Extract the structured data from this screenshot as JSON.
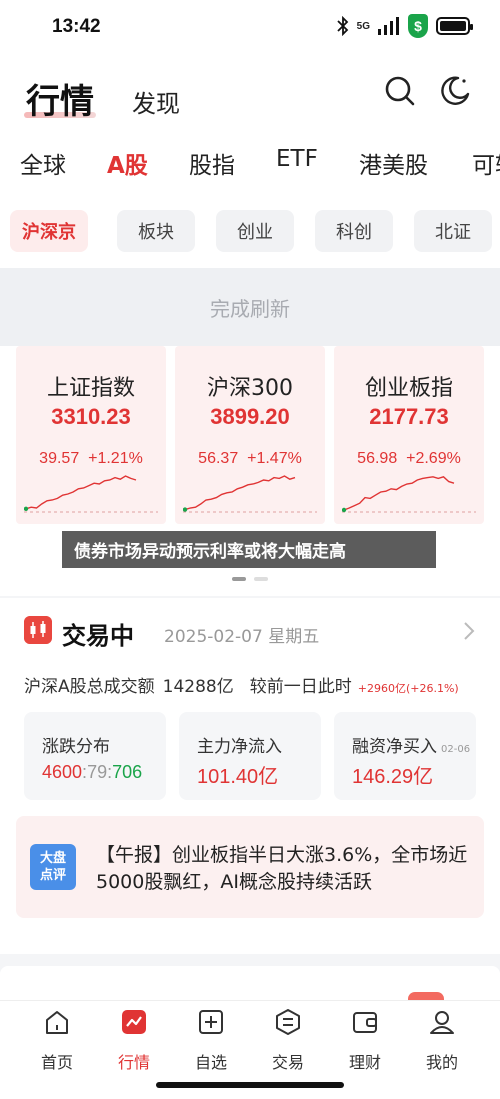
{
  "status": {
    "time": "13:42",
    "network": "5G",
    "shield_symbol": "$"
  },
  "header": {
    "title": "行情",
    "subtitle": "发现",
    "search_icon": "search-icon",
    "theme_icon": "moon-icon"
  },
  "tabs": [
    "全球",
    "A股",
    "股指",
    "ETF",
    "港美股",
    "可转"
  ],
  "active_tab": "A股",
  "chips": [
    "沪深京",
    "板块",
    "创业",
    "科创",
    "北证"
  ],
  "active_chip": "沪深京",
  "refresh_text": "完成刷新",
  "indices": [
    {
      "name": "上证指数",
      "value": "3310.23",
      "change": "39.57",
      "pct": "+1.21%",
      "spark": [
        0.08,
        0.12,
        0.1,
        0.2,
        0.28,
        0.3,
        0.34,
        0.42,
        0.45,
        0.5,
        0.58,
        0.6,
        0.66,
        0.72,
        0.7,
        0.78,
        0.8,
        0.86,
        0.82,
        0.9,
        0.84,
        0.8
      ]
    },
    {
      "name": "沪深300",
      "value": "3899.20",
      "change": "56.37",
      "pct": "+1.47%",
      "spark": [
        0.06,
        0.1,
        0.12,
        0.2,
        0.3,
        0.32,
        0.36,
        0.44,
        0.48,
        0.5,
        0.58,
        0.62,
        0.68,
        0.7,
        0.74,
        0.8,
        0.78,
        0.86,
        0.84,
        0.9,
        0.82,
        0.86
      ]
    },
    {
      "name": "创业板指",
      "value": "2177.73",
      "change": "56.98",
      "pct": "+2.69%",
      "spark": [
        0.05,
        0.1,
        0.16,
        0.22,
        0.36,
        0.34,
        0.42,
        0.5,
        0.52,
        0.58,
        0.56,
        0.64,
        0.7,
        0.72,
        0.8,
        0.84,
        0.86,
        0.88,
        0.84,
        0.88,
        0.76,
        0.72
      ]
    }
  ],
  "headline_overlay": "债券市场异动预示利率或将大幅走高",
  "trade": {
    "title": "交易中",
    "date": "2025-02-07 星期五",
    "volume_label": "沪深A股总成交额",
    "volume_value": "14288亿",
    "compare_label": "较前一日此时",
    "compare_value": "+2960亿(+26.1%)"
  },
  "stats": {
    "breadth": {
      "label": "涨跌分布",
      "up": "4600",
      "flat": "79",
      "down": "706"
    },
    "main_flow": {
      "label": "主力净流入",
      "value": "101.40亿"
    },
    "margin": {
      "label": "融资净买入",
      "date": "02-06",
      "value": "146.29亿"
    }
  },
  "news": {
    "badge_line1": "大盘",
    "badge_line2": "点评",
    "text": "【午报】创业板指半日大涨3.6%，全市场近5000股飘红，AI概念股持续活跃"
  },
  "nav": [
    {
      "label": "首页",
      "icon": "home-icon"
    },
    {
      "label": "行情",
      "icon": "chart-icon"
    },
    {
      "label": "自选",
      "icon": "watchlist-plus-icon"
    },
    {
      "label": "交易",
      "icon": "trade-exchange-icon"
    },
    {
      "label": "理财",
      "icon": "wallet-icon"
    },
    {
      "label": "我的",
      "icon": "profile-icon"
    }
  ],
  "active_nav": "行情",
  "colors": {
    "accent": "#e03434",
    "down": "#1aa44a",
    "card_bg": "#fdf0f0"
  }
}
